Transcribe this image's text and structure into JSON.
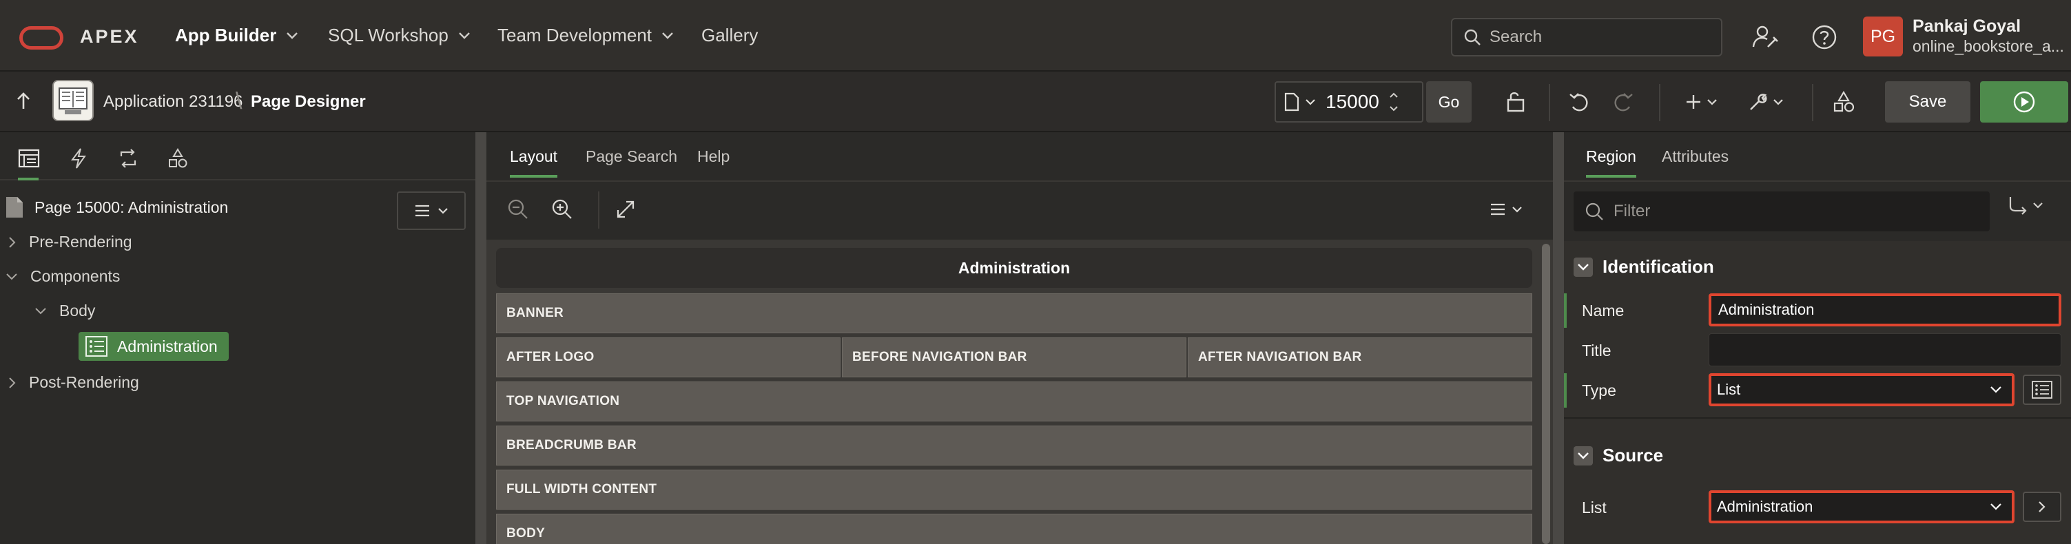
{
  "colors": {
    "brand": "#c74634",
    "accent_green": "#4e8b4c",
    "highlight_red": "#e0452f",
    "bg_dark": "#2b2a28"
  },
  "header": {
    "brand": "APEX",
    "nav": [
      {
        "label": "App Builder",
        "active": true
      },
      {
        "label": "SQL Workshop"
      },
      {
        "label": "Team Development"
      },
      {
        "label": "Gallery"
      }
    ],
    "search_placeholder": "Search",
    "user": {
      "initials": "PG",
      "name": "Pankaj Goyal",
      "workspace": "online_bookstore_a..."
    }
  },
  "toolbar": {
    "app_crumb": "Application 231196",
    "page_crumb": "Page Designer",
    "separator": "\\",
    "page_number": "15000",
    "go_label": "Go",
    "save_label": "Save"
  },
  "left": {
    "page_title": "Page 15000: Administration",
    "tree": {
      "pre_rendering": "Pre-Rendering",
      "components": "Components",
      "body": "Body",
      "selected_region": "Administration",
      "post_rendering": "Post-Rendering"
    }
  },
  "center": {
    "tabs": [
      "Layout",
      "Page Search",
      "Help"
    ],
    "region_title": "Administration",
    "positions": {
      "banner": "BANNER",
      "after_logo": "AFTER LOGO",
      "before_nav": "BEFORE NAVIGATION BAR",
      "after_nav": "AFTER NAVIGATION BAR",
      "top_nav": "TOP NAVIGATION",
      "breadcrumb": "BREADCRUMB BAR",
      "full_width": "FULL WIDTH CONTENT",
      "body": "BODY"
    }
  },
  "right": {
    "tabs": [
      "Region",
      "Attributes"
    ],
    "filter_placeholder": "Filter",
    "identification": {
      "heading": "Identification",
      "name_label": "Name",
      "name_value": "Administration",
      "title_label": "Title",
      "title_value": "",
      "type_label": "Type",
      "type_value": "List"
    },
    "source": {
      "heading": "Source",
      "list_label": "List",
      "list_value": "Administration"
    }
  }
}
